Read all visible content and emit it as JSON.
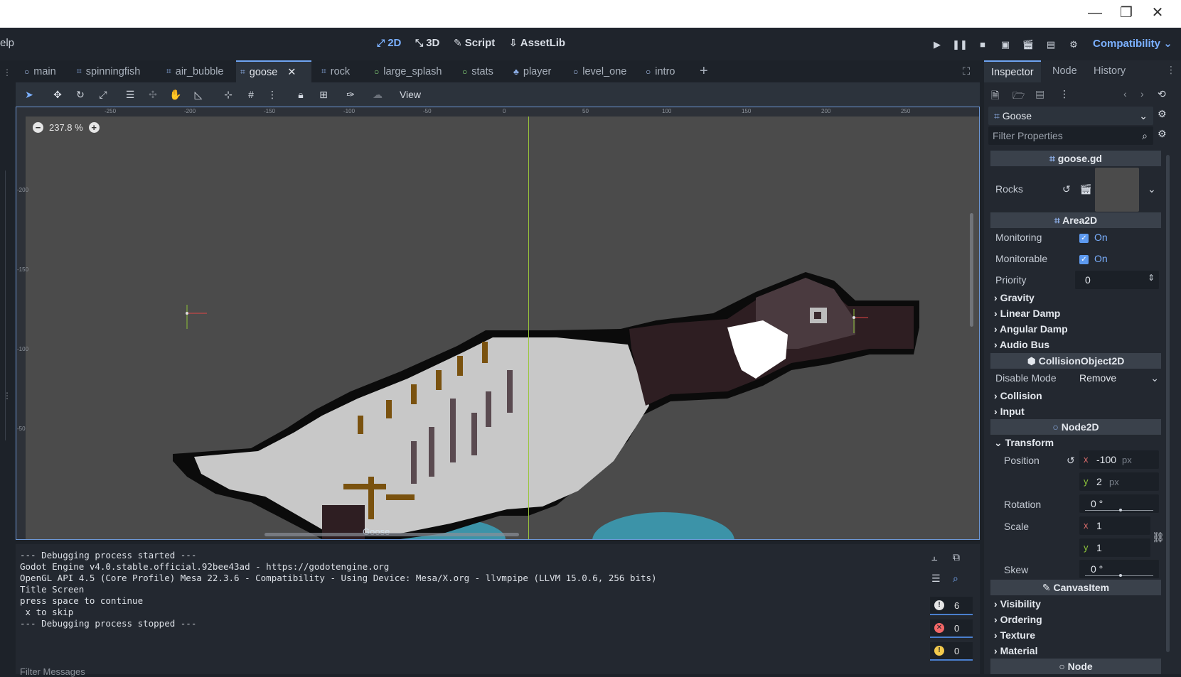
{
  "window": {
    "minimize": "—",
    "restore": "❐",
    "close": "✕"
  },
  "menu": {
    "help_partial": "elp"
  },
  "workspaces": [
    {
      "label": "2D",
      "icon": "2d-icon"
    },
    {
      "label": "3D",
      "icon": "3d-icon"
    },
    {
      "label": "Script",
      "icon": "script-icon"
    },
    {
      "label": "AssetLib",
      "icon": "assetlib-icon"
    }
  ],
  "renderer": "Compatibility",
  "scene_tabs": [
    "main",
    "spinningfish",
    "air_bubble",
    "goose",
    "rock",
    "large_splash",
    "stats",
    "player",
    "level_one",
    "intro"
  ],
  "active_tab": "goose",
  "toolbar": {
    "view_label": "View"
  },
  "viewport": {
    "zoom": "237.8 %",
    "node_label": "Goose",
    "ruler_top": [
      "-250",
      "-200",
      "-150",
      "-100",
      "-50",
      "0",
      "50",
      "100",
      "150",
      "200",
      "250"
    ],
    "ruler_left": [
      "-200",
      "-150",
      "-100",
      "-50"
    ]
  },
  "output": {
    "lines": [
      "--- Debugging process started ---",
      "Godot Engine v4.0.stable.official.92bee43ad - https://godotengine.org",
      "OpenGL API 4.5 (Core Profile) Mesa 22.3.6 - Compatibility - Using Device: Mesa/X.org - llvmpipe (LLVM 15.0.6, 256 bits)",
      "",
      "Title Screen",
      "press space to continue",
      " x to skip",
      "--- Debugging process stopped ---"
    ],
    "filter_placeholder": "Filter Messages",
    "counts": {
      "messages": "6",
      "errors": "0",
      "warnings": "0"
    }
  },
  "inspector": {
    "tabs": [
      "Inspector",
      "Node",
      "History"
    ],
    "object_name": "Goose",
    "filter_placeholder": "Filter Properties",
    "script_header": "goose.gd",
    "rocks_label": "Rocks",
    "area2d": {
      "header": "Area2D",
      "monitoring_label": "Monitoring",
      "monitoring_value": "On",
      "monitorable_label": "Monitorable",
      "monitorable_value": "On",
      "priority_label": "Priority",
      "priority_value": "0",
      "groups": [
        "Gravity",
        "Linear Damp",
        "Angular Damp",
        "Audio Bus"
      ]
    },
    "collision": {
      "header": "CollisionObject2D",
      "disable_mode_label": "Disable Mode",
      "disable_mode_value": "Remove",
      "groups": [
        "Collision",
        "Input"
      ]
    },
    "node2d": {
      "header": "Node2D",
      "transform_label": "Transform",
      "position_label": "Position",
      "pos_x": "-100",
      "pos_y": "2",
      "unit": "px",
      "rotation_label": "Rotation",
      "rotation_value": "0 °",
      "scale_label": "Scale",
      "scale_x": "1",
      "scale_y": "1",
      "skew_label": "Skew",
      "skew_value": "0 °"
    },
    "canvas": {
      "header": "CanvasItem",
      "groups": [
        "Visibility",
        "Ordering",
        "Texture",
        "Material"
      ]
    },
    "node_header": "Node"
  },
  "colors": {
    "accent": "#7bb0ff",
    "viewport_bg": "#4b4b4b",
    "panel": "#232830"
  }
}
